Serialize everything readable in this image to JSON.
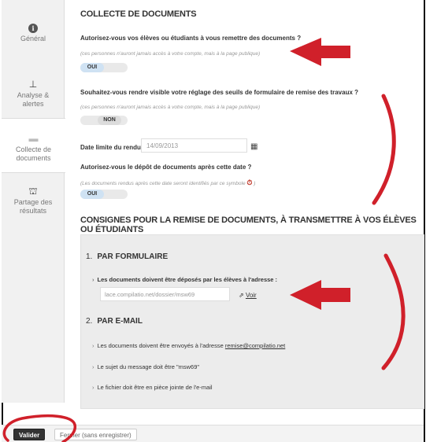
{
  "sidebar": {
    "items": [
      {
        "label": "Général",
        "icon": "info-icon"
      },
      {
        "label": "Analyse & alertes",
        "icon": "analysis-icon"
      },
      {
        "label": "Collecte de documents",
        "icon": "inbox-icon",
        "active": true
      },
      {
        "label": "Partage des résultats",
        "icon": "share-icon"
      }
    ]
  },
  "main": {
    "title": "COLLECTE DE DOCUMENTS",
    "q1": {
      "label": "Autorisez-vous vos élèves ou étudiants à vous remettre des documents ?",
      "note": "(ces personnes n'auront jamais accès à votre compte, mais à la page publique)",
      "toggle": "OUI"
    },
    "q2": {
      "label": "Souhaitez-vous rendre visible votre réglage des seuils de formulaire de remise des travaux ?",
      "note": "(ces personnes n'auront jamais accès à votre compte, mais à la page publique)",
      "toggle": "NON"
    },
    "date": {
      "label": "Date limite du rendu :",
      "value": "14/09/2013"
    },
    "q3": {
      "label": "Autorisez-vous le dépôt de documents après cette date ?",
      "note": "(Les documents rendus après cette date seront identifiés par ce symbole",
      "note_end": ")",
      "toggle": "OUI"
    },
    "section_title": "CONSIGNES POUR LA REMISE DE DOCUMENTS, À TRANSMETTRE À VOS ÉLÈVES OU ÉTUDIANTS",
    "form": {
      "num": "1.",
      "title": "PAR FORMULAIRE",
      "bullet": "Les documents doivent être déposés par les élèves à l'adresse :",
      "url": "lace.compilatio.net/dossier/msw69",
      "voir": "Voir"
    },
    "email": {
      "num": "2.",
      "title": "PAR E-MAIL",
      "b1_text": "Les documents doivent être envoyés à l'adresse",
      "b1_link": "remise@compilatio.net",
      "b2": "Le sujet du message doit être \"msw69\"",
      "b3": "Le fichier doit être en pièce jointe de l'e-mail"
    }
  },
  "footer": {
    "valider": "Valider",
    "fermer": "Fermer (sans enregistrer)"
  },
  "colors": {
    "annotation": "#d0202a",
    "toggle_on": "#cfe2f3"
  }
}
